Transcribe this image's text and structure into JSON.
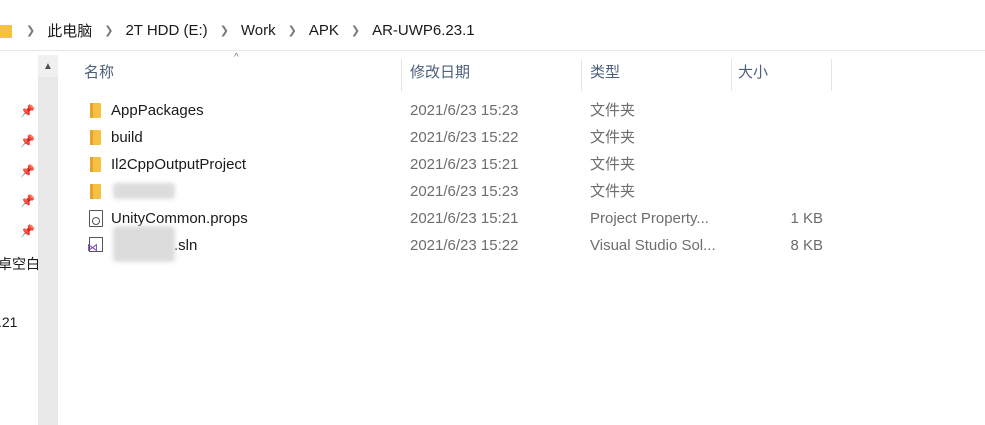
{
  "breadcrumb": [
    "此电脑",
    "2T HDD (E:)",
    "Work",
    "APK",
    "AR-UWP6.23.1"
  ],
  "left_pane": {
    "labels": [
      "卓空白",
      ".21"
    ]
  },
  "columns": {
    "name": "名称",
    "date": "修改日期",
    "type": "类型",
    "size": "大小"
  },
  "files": [
    {
      "name": "AppPackages",
      "date": "2021/6/23 15:23",
      "type": "文件夹",
      "size": "",
      "icon": "folder-icon"
    },
    {
      "name": "build",
      "date": "2021/6/23 15:22",
      "type": "文件夹",
      "size": "",
      "icon": "folder-icon"
    },
    {
      "name": "Il2CppOutputProject",
      "date": "2021/6/23 15:21",
      "type": "文件夹",
      "size": "",
      "icon": "folder-icon"
    },
    {
      "name": "",
      "date": "2021/6/23 15:23",
      "type": "文件夹",
      "size": "",
      "icon": "folder-icon"
    },
    {
      "name": "UnityCommon.props",
      "date": "2021/6/23 15:21",
      "type": "Project Property...",
      "size": "1 KB",
      "icon": "props-file-icon"
    },
    {
      "name": ".sln",
      "date": "2021/6/23 15:22",
      "type": "Visual Studio Sol...",
      "size": "8 KB",
      "icon": "visual-studio-solution-icon"
    }
  ],
  "colors": {
    "header_text": "#4c607a",
    "folder": "#f6c142",
    "secondary_text": "#6d6d6d"
  }
}
